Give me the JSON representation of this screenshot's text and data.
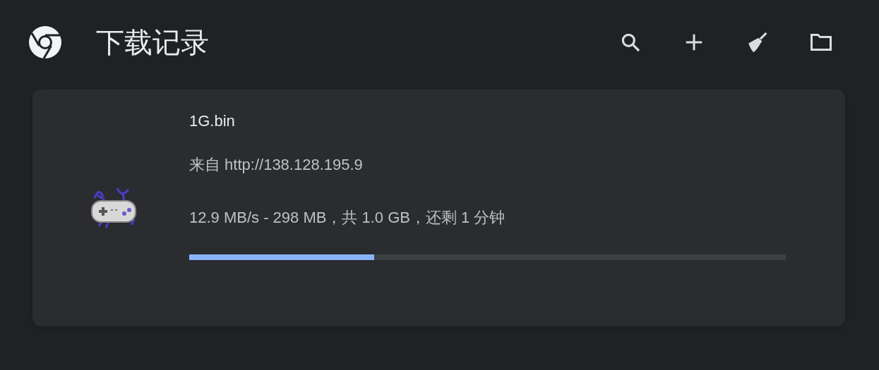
{
  "header": {
    "title": "下载记录"
  },
  "download": {
    "file_name": "1G.bin",
    "source": "来自 http://138.128.195.9",
    "status": "12.9 MB/s - 298 MB，共 1.0 GB，还剩 1 分钟",
    "level": 0.31
  }
}
